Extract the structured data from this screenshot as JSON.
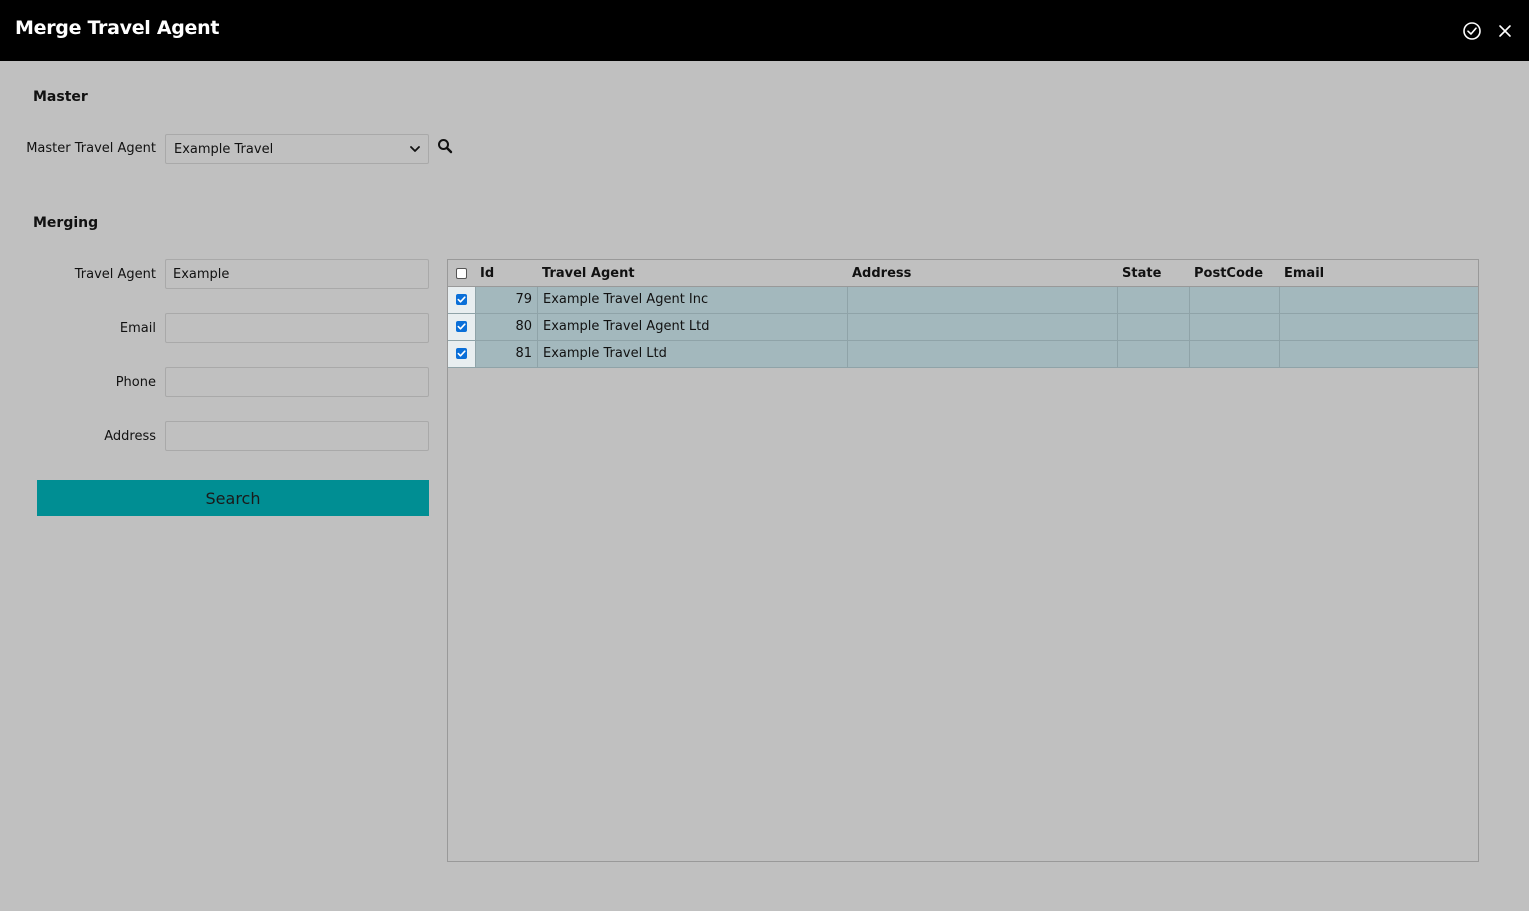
{
  "window": {
    "title": "Merge Travel Agent"
  },
  "master": {
    "section_title": "Master",
    "agent_label": "Master Travel Agent",
    "agent_value": "Example Travel"
  },
  "merging": {
    "section_title": "Merging",
    "fields": {
      "travel_agent_label": "Travel Agent",
      "travel_agent_value": "Example",
      "email_label": "Email",
      "email_value": "",
      "phone_label": "Phone",
      "phone_value": "",
      "address_label": "Address",
      "address_value": ""
    },
    "search_label": "Search"
  },
  "grid": {
    "columns": [
      "Id",
      "Travel Agent",
      "Address",
      "State",
      "PostCode",
      "Email"
    ],
    "rows": [
      {
        "checked": true,
        "id": "79",
        "travel_agent": "Example Travel Agent Inc",
        "address": "",
        "state": "",
        "postcode": "",
        "email": ""
      },
      {
        "checked": true,
        "id": "80",
        "travel_agent": "Example Travel Agent Ltd",
        "address": "",
        "state": "",
        "postcode": "",
        "email": ""
      },
      {
        "checked": true,
        "id": "81",
        "travel_agent": "Example Travel Ltd",
        "address": "",
        "state": "",
        "postcode": "",
        "email": ""
      }
    ]
  },
  "icons": {
    "confirm": "check-circle-icon",
    "close": "close-icon",
    "search": "search-icon",
    "dropdown": "chevron-down-icon"
  },
  "colors": {
    "titlebar": "#000000",
    "background": "#c0c0c0",
    "accent": "#008e93",
    "row_selected": "#a3b8bd",
    "checkbox": "#0a6fd8"
  }
}
